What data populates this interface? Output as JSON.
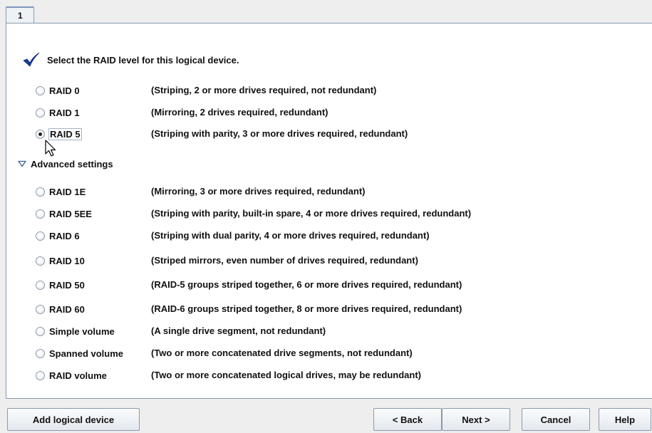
{
  "tab": {
    "label": "1"
  },
  "header": {
    "text": "Select the RAID level for this logical device."
  },
  "options_main": [
    {
      "label": "RAID 0",
      "description": "(Striping, 2 or more drives required, not redundant)",
      "selected": false
    },
    {
      "label": "RAID 1",
      "description": "(Mirroring, 2 drives required, redundant)",
      "selected": false
    },
    {
      "label": "RAID 5",
      "description": "(Striping with parity, 3 or more drives required, redundant)",
      "selected": true
    }
  ],
  "advanced": {
    "label": "Advanced settings",
    "expanded": true,
    "options": [
      {
        "label": "RAID 1E",
        "description": "(Mirroring, 3 or more drives required, redundant)",
        "selected": false
      },
      {
        "label": "RAID 5EE",
        "description": "(Striping with parity, built-in spare, 4 or more drives required, redundant)",
        "selected": false
      },
      {
        "label": "RAID 6",
        "description": "(Striping with dual parity, 4 or more drives required, redundant)",
        "selected": false
      },
      {
        "label": "RAID 10",
        "description": "(Striped mirrors, even number of drives required, redundant)",
        "selected": false
      },
      {
        "label": "RAID 50",
        "description": "(RAID-5 groups striped together, 6 or more drives required, redundant)",
        "selected": false
      },
      {
        "label": "RAID 60",
        "description": "(RAID-6 groups striped together, 8 or more drives required, redundant)",
        "selected": false
      },
      {
        "label": "Simple volume",
        "description": "(A single drive segment, not redundant)",
        "selected": false
      },
      {
        "label": "Spanned volume",
        "description": "(Two or more concatenated drive segments, not redundant)",
        "selected": false
      },
      {
        "label": "RAID volume",
        "description": "(Two or more concatenated logical drives, may be redundant)",
        "selected": false
      }
    ]
  },
  "buttons": {
    "add_logical_device": "Add logical device",
    "back": "< Back",
    "next": "Next >",
    "cancel": "Cancel",
    "help": "Help"
  },
  "colors": {
    "checkmark": "#1a3d9e",
    "panel_bg": "#ffffff",
    "window_bg": "#eeeeee"
  },
  "icons": {
    "header": "checkmark-icon",
    "advanced_toggle": "triangle-down-icon",
    "pointer": "mouse-cursor-icon"
  }
}
